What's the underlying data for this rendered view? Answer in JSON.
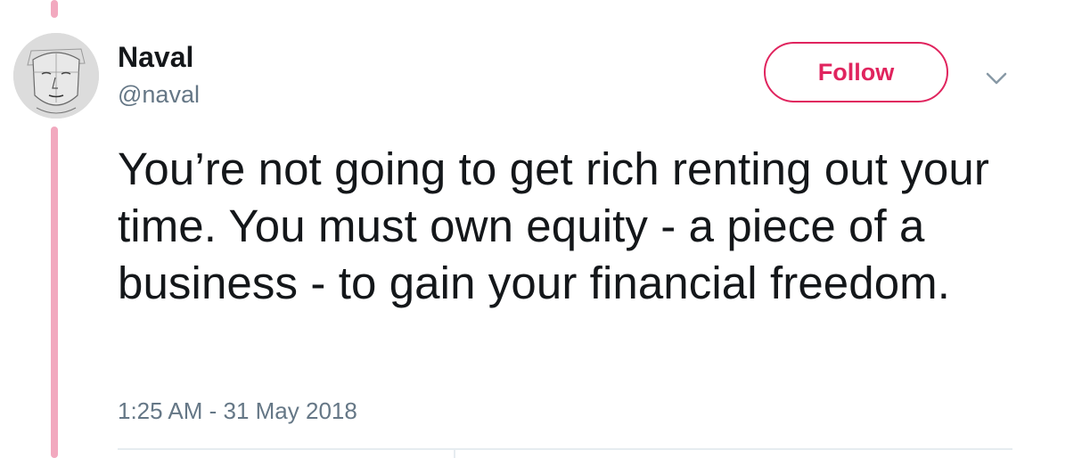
{
  "thread": {
    "line_color": "#f2a9bf"
  },
  "author": {
    "display_name": "Naval",
    "screen_name": "@naval",
    "avatar_icon": "sketch-face-avatar"
  },
  "actions": {
    "follow_label": "Follow",
    "follow_color": "#e0245e",
    "more_icon": "chevron-down-icon"
  },
  "tweet": {
    "text": "You’re not going to get rich renting out your time. You must own equity - a piece of a business - to gain your financial freedom.",
    "timestamp": "1:25 AM - 31 May 2018"
  },
  "colors": {
    "text_primary": "#14171a",
    "text_secondary": "#657786",
    "divider": "#e6ecf0"
  }
}
